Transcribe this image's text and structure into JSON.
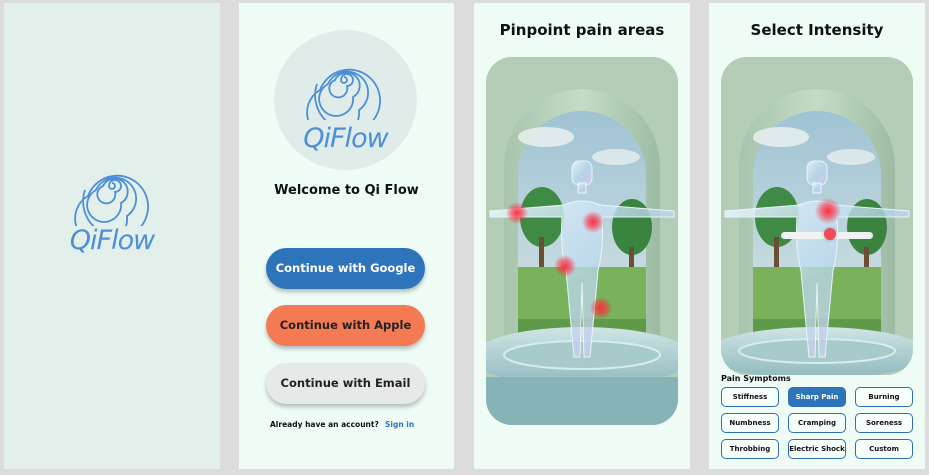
{
  "colors": {
    "brand": "#4d8fd6",
    "google": "#2d74ba",
    "apple": "#f47a54",
    "email": "#e6e9e7",
    "pain": "#ff283c",
    "chip_border": "#2c6fb3"
  },
  "splash": {
    "logo_text": "QiFlow",
    "logo_icon": "spiral-icon"
  },
  "welcome": {
    "logo_text": "QiFlow",
    "title": "Welcome to Qi Flow",
    "google_label": "Continue with Google",
    "apple_label": "Continue with Apple",
    "email_label": "Continue with Email",
    "account_prompt": "Already have an account?",
    "sign_in_label": "Sign in"
  },
  "pinpoint": {
    "title": "Pinpoint pain areas"
  },
  "intensity": {
    "title": "Select Intensity",
    "slider_value": 0.5,
    "symptoms_title": "Pain Symptoms",
    "symptoms": [
      {
        "label": "Stiffness",
        "selected": false
      },
      {
        "label": "Sharp Pain",
        "selected": true
      },
      {
        "label": "Burning",
        "selected": false
      },
      {
        "label": "Numbness",
        "selected": false
      },
      {
        "label": "Cramping",
        "selected": false
      },
      {
        "label": "Soreness",
        "selected": false
      },
      {
        "label": "Throbbing",
        "selected": false
      },
      {
        "label": "Electric Shock",
        "selected": false
      },
      {
        "label": "Custom",
        "selected": false
      }
    ]
  }
}
